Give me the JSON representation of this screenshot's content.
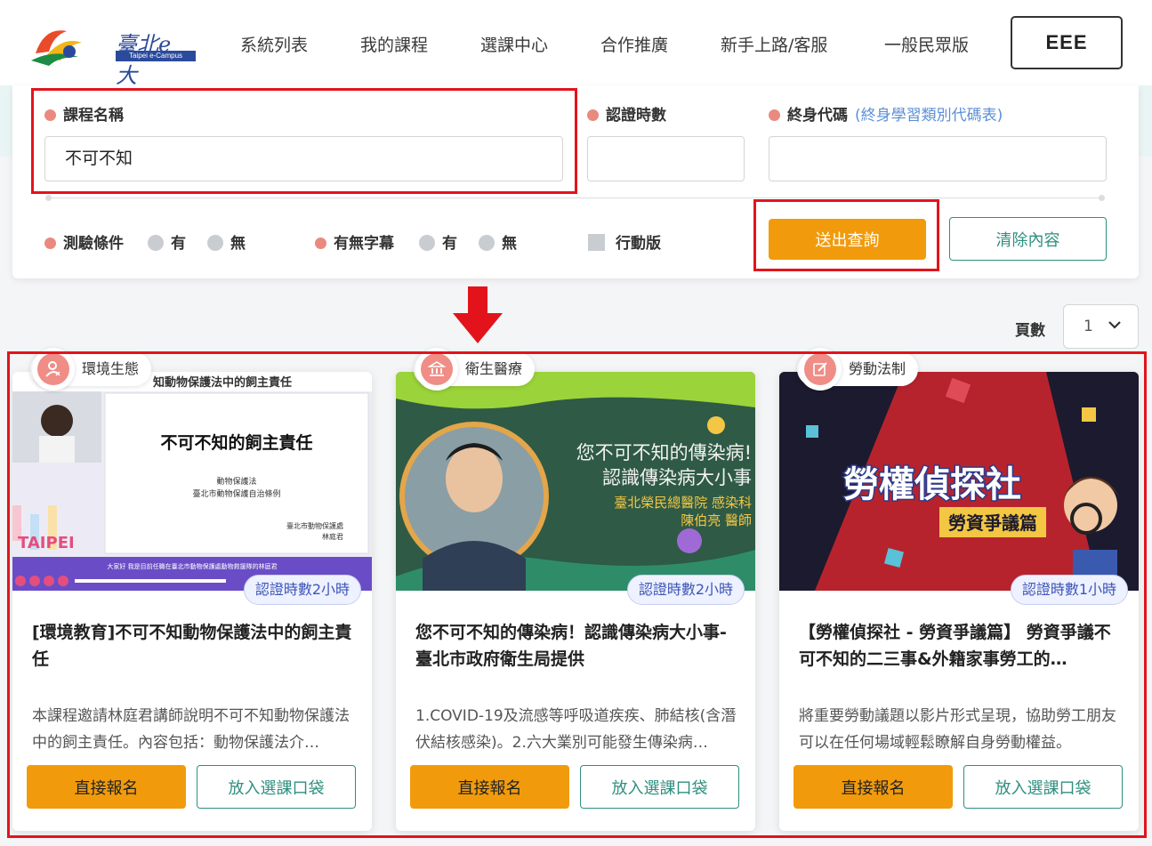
{
  "header": {
    "logo_text": "臺北e大",
    "logo_sub": "Taipei e-Campus",
    "nav": [
      "系統列表",
      "我的課程",
      "選課中心",
      "合作推廣",
      "新手上路/客服",
      "一般民眾版"
    ],
    "lang_button": "EEE"
  },
  "search": {
    "course_name_label": "課程名稱",
    "course_name_value": "不可不知",
    "cert_hours_label": "認證時數",
    "cert_hours_value": "",
    "lifelong_code_label": "終身代碼",
    "lifelong_code_link": "(終身學習類別代碼表)",
    "lifelong_code_value": "",
    "exam_label": "測驗條件",
    "exam_yes": "有",
    "exam_no": "無",
    "subtitle_label": "有無字幕",
    "subtitle_yes": "有",
    "subtitle_no": "無",
    "mobile_label": "行動版",
    "submit_label": "送出查詢",
    "clear_label": "清除內容"
  },
  "pagination": {
    "label": "頁數",
    "value": "1"
  },
  "cards": [
    {
      "category": "環境生態",
      "hours": "認證時數2小時",
      "title": "[環境教育]不可不知動物保護法中的飼主責任",
      "desc": "本課程邀請林庭君講師說明不可不知動物保護法中的飼主責任。內容包括：動物保護法介…",
      "thumb_title": "知動物保護法中的飼主責任",
      "thumb_main": "不可不知的飼主責任",
      "thumb_sub1": "動物保護法",
      "thumb_sub2": "臺北市動物保護自治條例",
      "thumb_org": "臺北市動物保護處",
      "thumb_name": "林庭君",
      "thumb_brand": "TAIPEI",
      "thumb_caption": "大家好 我是目前任職在臺北市動物保護處動物救援隊的林庭君",
      "enroll": "直接報名",
      "cart": "放入選課口袋"
    },
    {
      "category": "衛生醫療",
      "hours": "認證時數2小時",
      "title": "您不可不知的傳染病！認識傳染病大小事-臺北市政府衛生局提供",
      "desc": "1.COVID-19及流感等呼吸道疾疾、肺結核(含潛伏結核感染)。2.六大業別可能發生傳染病…",
      "thumb_line1": "您不可不知的傳染病!",
      "thumb_line2": "認識傳染病大小事",
      "thumb_line3": "臺北榮民總醫院 感染科",
      "thumb_line4": "陳伯亮 醫師",
      "enroll": "直接報名",
      "cart": "放入選課口袋"
    },
    {
      "category": "勞動法制",
      "hours": "認證時數1小時",
      "title": "【勞權偵探社 - 勞資爭議篇】 勞資爭議不可不知的二三事&外籍家事勞工的…",
      "desc": "將重要勞動議題以影片形式呈現，協助勞工朋友可以在任何場域輕鬆瞭解自身勞動權益。",
      "thumb_line1": "勞權偵探社",
      "thumb_line2": "勞資爭議篇",
      "enroll": "直接報名",
      "cart": "放入選課口袋"
    }
  ],
  "colors": {
    "accent_orange": "#f19b0c",
    "teal": "#2f8f7f",
    "highlight_red": "#e3131b",
    "dot_pink": "#ea8a7f"
  }
}
